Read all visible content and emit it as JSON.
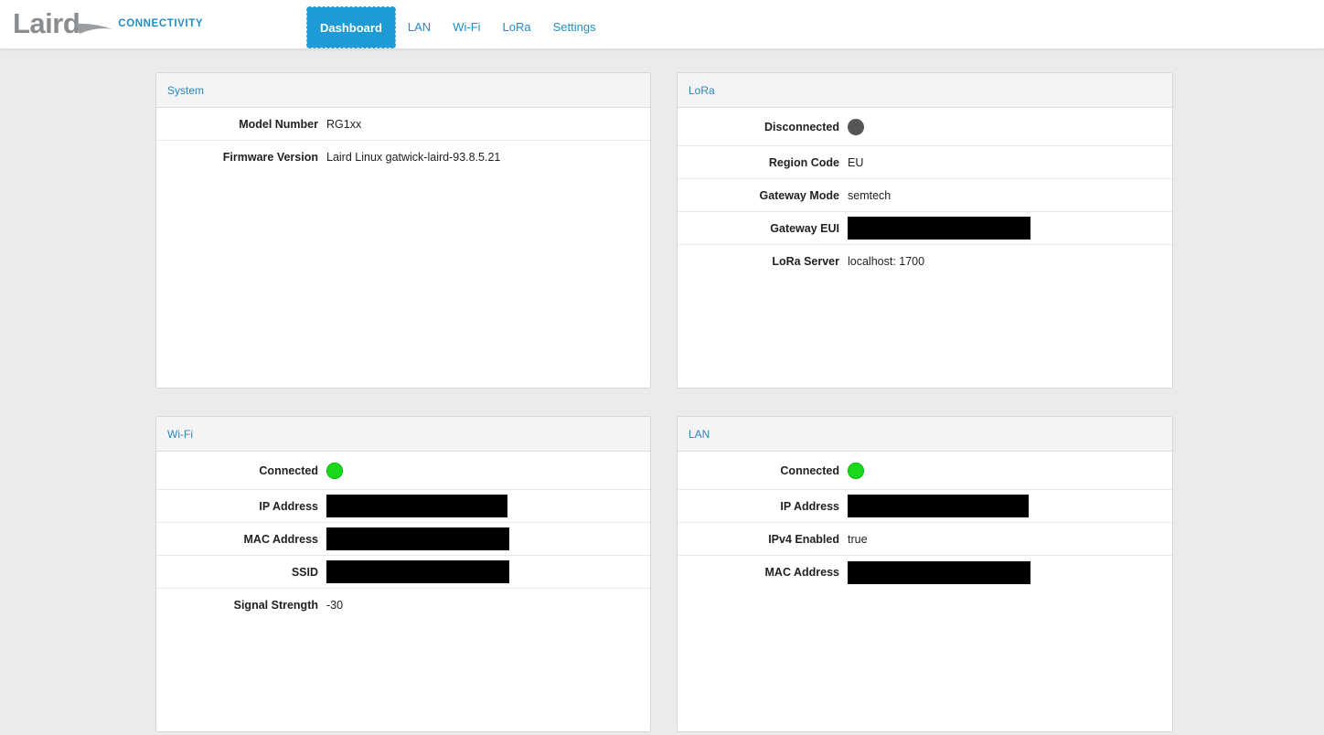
{
  "brand": {
    "name": "Laird",
    "tagline": "CONNECTIVITY"
  },
  "nav": {
    "items": [
      {
        "label": "Dashboard",
        "active": true
      },
      {
        "label": "LAN",
        "active": false
      },
      {
        "label": "Wi-Fi",
        "active": false
      },
      {
        "label": "LoRa",
        "active": false
      },
      {
        "label": "Settings",
        "active": false
      }
    ]
  },
  "panels": {
    "system": {
      "title": "System",
      "rows": [
        {
          "label": "Model Number",
          "value": "RG1xx"
        },
        {
          "label": "Firmware Version",
          "value": "Laird Linux gatwick-laird-93.8.5.21"
        }
      ]
    },
    "lora": {
      "title": "LoRa",
      "status_label": "Disconnected",
      "status_color": "#555555",
      "rows": [
        {
          "label": "Region Code",
          "value": "EU"
        },
        {
          "label": "Gateway Mode",
          "value": "semtech"
        },
        {
          "label": "Gateway EUI",
          "value": "[redacted]"
        },
        {
          "label": "LoRa Server",
          "value": "localhost: 1700"
        }
      ]
    },
    "wifi": {
      "title": "Wi-Fi",
      "status_label": "Connected",
      "status_color": "#1cd81c",
      "rows": [
        {
          "label": "IP Address",
          "value": "[redacted]"
        },
        {
          "label": "MAC Address",
          "value": "[redacted]"
        },
        {
          "label": "SSID",
          "value": "[redacted]"
        },
        {
          "label": "Signal Strength",
          "value": "-30"
        }
      ]
    },
    "lan": {
      "title": "LAN",
      "status_label": "Connected",
      "status_color": "#1cd81c",
      "rows": [
        {
          "label": "IP Address",
          "value": "[redacted]"
        },
        {
          "label": "IPv4 Enabled",
          "value": "true"
        },
        {
          "label": "MAC Address",
          "value": "[redacted]"
        }
      ]
    }
  },
  "colors": {
    "accent": "#1e9ad6",
    "link": "#1e8fc6",
    "background": "#ebebeb"
  }
}
